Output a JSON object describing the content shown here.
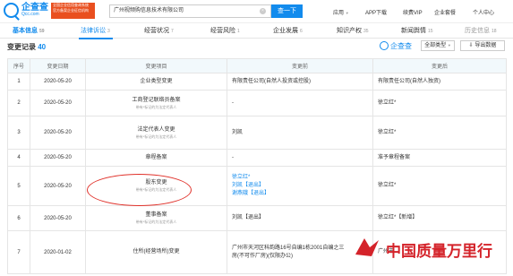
{
  "header": {
    "logo_cn": "企查查",
    "logo_en": "Qcc.com",
    "tagline": "全国企业信用查询系统 官方备案企业征信机构",
    "search_value": "广州视频购信息技术有限公司",
    "search_button": "查一下",
    "nav": [
      "应用",
      "APP下载",
      "续费VIP",
      "企业套餐",
      "个人中心"
    ]
  },
  "tabs": [
    {
      "label": "基本信息",
      "count": "59"
    },
    {
      "label": "法律诉讼",
      "count": "3"
    },
    {
      "label": "经营状况",
      "count": "7"
    },
    {
      "label": "经营风险",
      "count": "1"
    },
    {
      "label": "企业发展",
      "count": "6"
    },
    {
      "label": "知识产权",
      "count": "35"
    },
    {
      "label": "新闻舆情",
      "count": "15"
    },
    {
      "label": "历史信息",
      "count": "18"
    }
  ],
  "section": {
    "title": "变更记录",
    "count": "40",
    "watermark": "企查查",
    "type_filter": "全部类型",
    "export": "导出数据"
  },
  "columns": [
    "序号",
    "变更日期",
    "变更项目",
    "变更前",
    "变更后"
  ],
  "rows": [
    {
      "idx": "1",
      "date": "2020-05-20",
      "item": "企业类型变更",
      "note": "",
      "before": "有限责任公司(自然人投资或控股)",
      "after": "有限责任公司(自然人独资)"
    },
    {
      "idx": "2",
      "date": "2020-05-20",
      "item": "工商登记联络员备案",
      "note": "带有*标记的为法定代表人",
      "before": "-",
      "after": "徐立红*"
    },
    {
      "idx": "3",
      "date": "2020-05-20",
      "item": "法定代表人变更",
      "note": "带有*标记的为法定代表人",
      "before": "刘凯",
      "after": "徐立红*"
    },
    {
      "idx": "4",
      "date": "2020-05-20",
      "item": "章程备案",
      "note": "",
      "before": "-",
      "after": "准予章程备案"
    },
    {
      "idx": "5",
      "date": "2020-05-20",
      "item": "股东变更",
      "note": "带有*标记的为法定代表人",
      "before_lines": [
        "徐立红*",
        "刘凯【退出】",
        "谢燕娥【退出】"
      ],
      "after": "徐立红*"
    },
    {
      "idx": "6",
      "date": "2020-05-20",
      "item": "董事备案",
      "note": "带有*标记的为法定代表人",
      "before": "刘凯【退出】",
      "after": "徐立红*【新增】"
    },
    {
      "idx": "7",
      "date": "2020-01-02",
      "item": "住所(经营场所)变更",
      "note": "",
      "before_lines": [
        "广州市天河区科韵路16号自编1栋2001自编之三",
        "房(不可作厂房)(仅限办公)"
      ],
      "after": "广州市..."
    }
  ],
  "news_watermark": "中国质量万里行"
}
